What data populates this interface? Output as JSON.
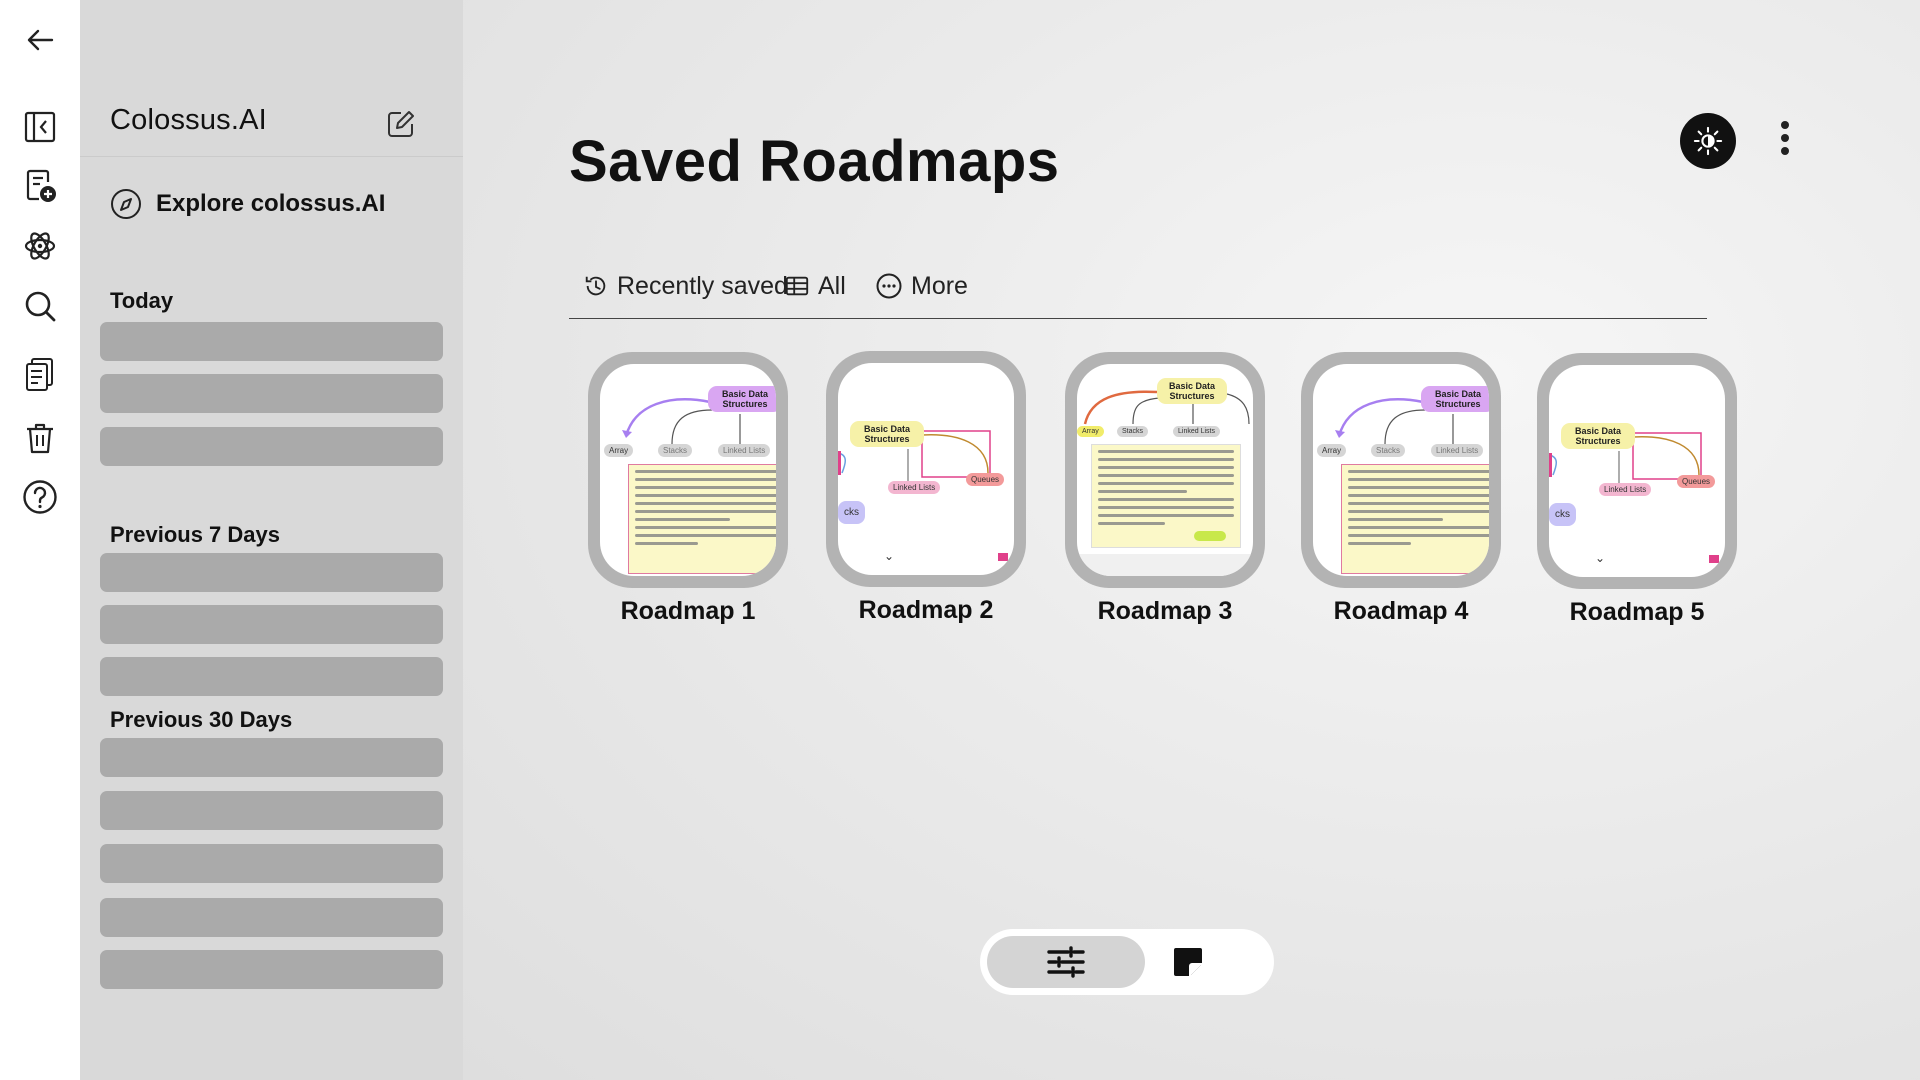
{
  "sidebar": {
    "brand": "Colossus.AI",
    "explore_label": "Explore colossus.AI",
    "sections": {
      "today": "Today",
      "prev7": "Previous 7 Days",
      "prev30": "Previous 30 Days"
    }
  },
  "main": {
    "title": "Saved Roadmaps",
    "tabs": {
      "recent": "Recently saved",
      "all": "All",
      "more": "More"
    },
    "roadmaps": {
      "r1": "Roadmap 1",
      "r2": "Roadmap 2",
      "r3": "Roadmap 3",
      "r4": "Roadmap 4",
      "r5": "Roadmap 5"
    },
    "thumb": {
      "root_node": "Basic Data Structures",
      "array": "Array",
      "stacks": "Stacks",
      "linked_lists": "Linked Lists",
      "queues": "Queues",
      "stacks_partial": "cks"
    }
  },
  "icons": {
    "rail": [
      "back-arrow-icon",
      "sidebar-collapse-icon",
      "new-document-icon",
      "atom-icon",
      "search-icon",
      "documents-icon",
      "trash-icon",
      "help-icon"
    ],
    "theme": "sun-icon",
    "menu": "kebab-menu-icon",
    "toggle": [
      "roadmap-view-icon",
      "notes-view-icon"
    ]
  },
  "colors": {
    "accent_purple": "#d9a6f2",
    "node_yellow": "#f6f1a8",
    "node_pink": "#f3b6d0",
    "node_red": "#f39a9a",
    "toggle_active": "#d4d4d4"
  }
}
